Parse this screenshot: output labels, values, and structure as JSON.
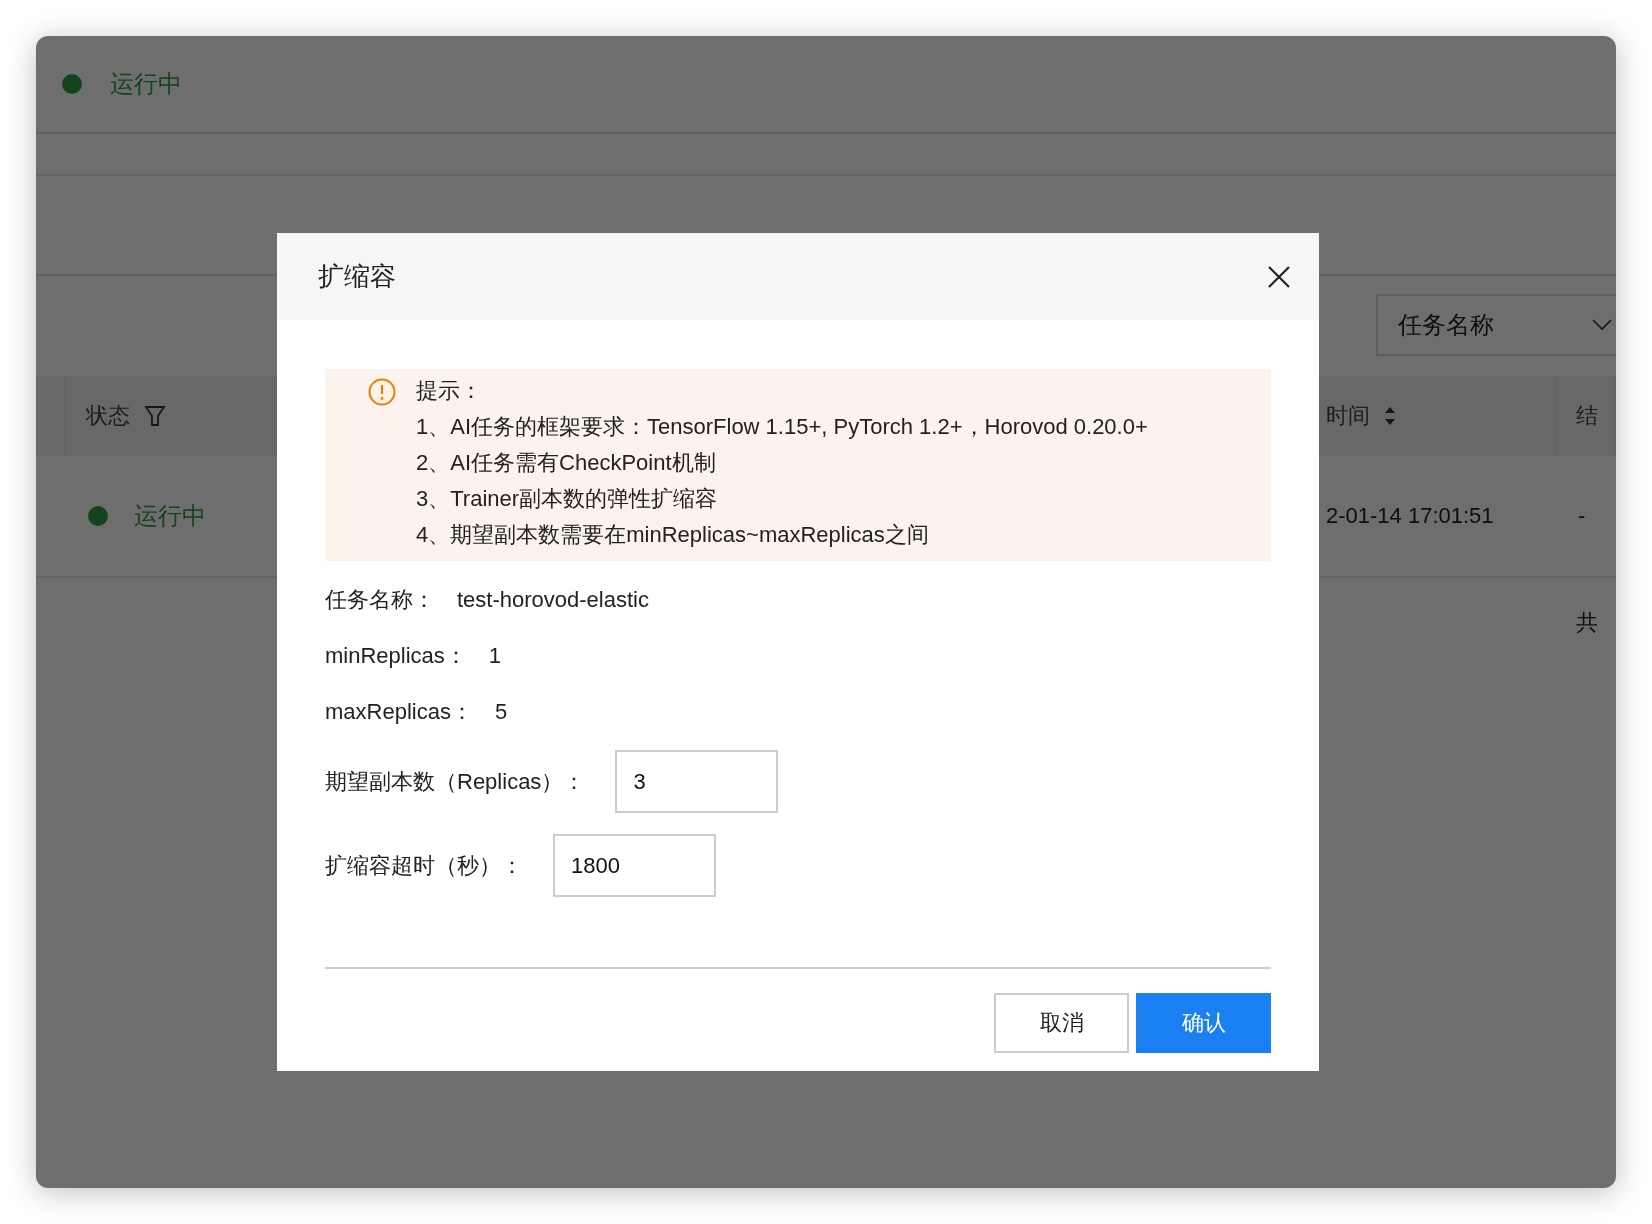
{
  "background": {
    "status_banner": {
      "label": "运行中"
    },
    "filter_select": {
      "value": "任务名称"
    },
    "table": {
      "columns": [
        {
          "label": "状态",
          "kind": "filter"
        },
        {
          "label": "时间",
          "kind": "sort"
        },
        {
          "label": "结",
          "kind": "plain"
        }
      ],
      "rows": [
        {
          "status": "运行中",
          "column_2": "2-01-14 17:01:51",
          "column_3": "-"
        }
      ]
    },
    "pagination": {
      "label": "共"
    }
  },
  "dialog": {
    "title": "扩缩容",
    "notice": {
      "title": "提示：",
      "lines": [
        "1、AI任务的框架要求：TensorFlow 1.15+, PyTorch 1.2+，Horovod 0.20.0+",
        "2、AI任务需有CheckPoint机制",
        "3、Trainer副本数的弹性扩缩容",
        "4、期望副本数需要在minReplicas~maxReplicas之间"
      ]
    },
    "info": [
      {
        "label": "任务名称：",
        "value": "test-horovod-elastic"
      },
      {
        "label": "minReplicas：",
        "value": "1"
      },
      {
        "label": "maxReplicas：",
        "value": "5"
      }
    ],
    "fields": [
      {
        "label": "期望副本数（Replicas）：",
        "value": "3"
      },
      {
        "label": "扩缩容超时（秒）：",
        "value": "1800"
      }
    ],
    "buttons": [
      {
        "label": "取消",
        "kind": "secondary"
      },
      {
        "label": "确认",
        "kind": "primary"
      }
    ]
  }
}
